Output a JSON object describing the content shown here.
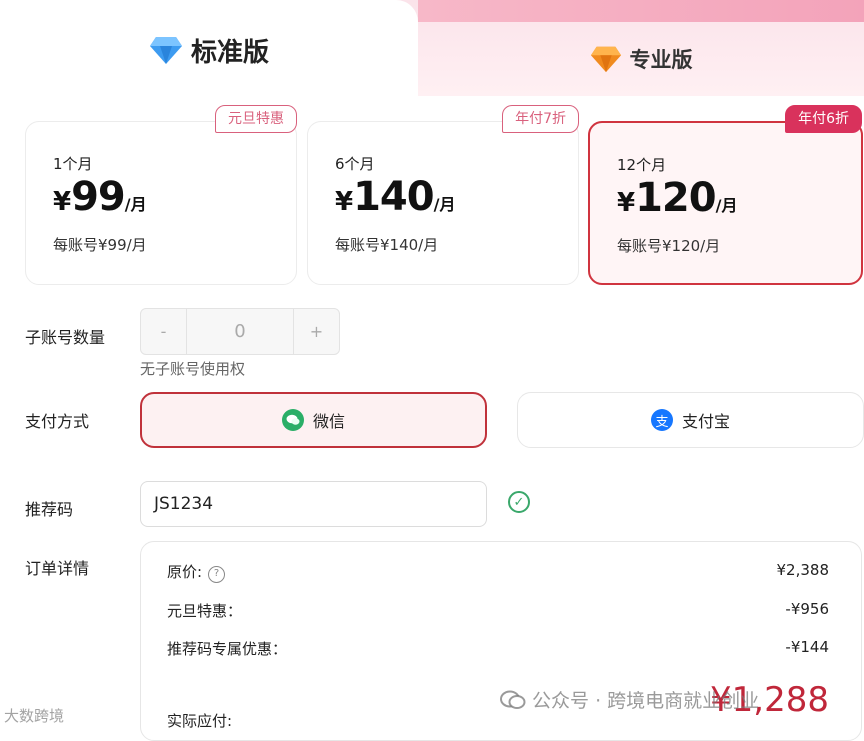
{
  "tabs": [
    {
      "label": "标准版",
      "icon": "blue-diamond-icon"
    },
    {
      "label": "专业版",
      "icon": "orange-diamond-icon"
    }
  ],
  "plans": [
    {
      "badge": "元旦特惠",
      "period": "1个月",
      "currency": "¥",
      "price": "99",
      "unit": "/月",
      "per_account": "每账号¥99/月"
    },
    {
      "badge": "年付7折",
      "period": "6个月",
      "currency": "¥",
      "price": "140",
      "unit": "/月",
      "per_account": "每账号¥140/月"
    },
    {
      "badge": "年付6折",
      "period": "12个月",
      "currency": "¥",
      "price": "120",
      "unit": "/月",
      "per_account": "每账号¥120/月",
      "selected": true
    }
  ],
  "sub_accounts": {
    "label": "子账号数量",
    "minus": "-",
    "value": "0",
    "plus": "+",
    "hint": "无子账号使用权"
  },
  "payment": {
    "label": "支付方式",
    "options": [
      {
        "label": "微信",
        "selected": true
      },
      {
        "label": "支付宝"
      }
    ]
  },
  "referral": {
    "label": "推荐码",
    "value": "JS1234"
  },
  "order": {
    "label": "订单详情",
    "original_label": "原价:",
    "original_help": "?",
    "original_value": "¥2,388",
    "discount_label": "元旦特惠：",
    "discount_value": "-¥956",
    "ref_label": "推荐码专属优惠：",
    "ref_value": "-¥144",
    "payable_label": "实际应付:",
    "payable_value": "¥1,288"
  },
  "watermarks": {
    "right": "公众号 · 跨境电商就业创业",
    "left": "大数跨境"
  },
  "colors": {
    "accent": "#c0273a",
    "badge": "#d9325c",
    "wechat": "#2aae67",
    "alipay": "#1677ff"
  }
}
